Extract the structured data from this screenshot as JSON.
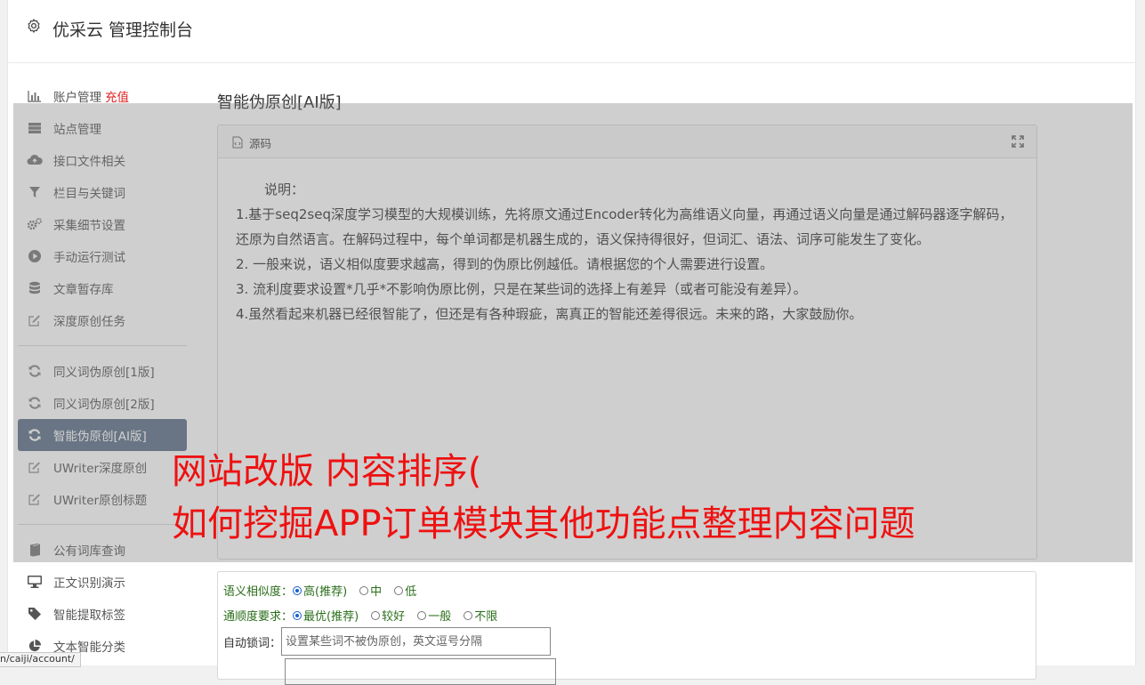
{
  "header": {
    "title": "优采云 管理控制台"
  },
  "sidebar": {
    "group1": [
      {
        "label": "账户管理",
        "extra": "充值",
        "icon": "bar-chart-icon"
      },
      {
        "label": "站点管理",
        "icon": "server-icon"
      },
      {
        "label": "接口文件相关",
        "icon": "cloud-upload-icon"
      },
      {
        "label": "栏目与关键词",
        "icon": "filter-icon"
      },
      {
        "label": "采集细节设置",
        "icon": "cogs-icon"
      },
      {
        "label": "手动运行测试",
        "icon": "play-icon"
      },
      {
        "label": "文章暂存库",
        "icon": "database-icon"
      },
      {
        "label": "深度原创任务",
        "icon": "edit-icon"
      }
    ],
    "group2": [
      {
        "label": "同义词伪原创[1版]",
        "icon": "refresh-icon"
      },
      {
        "label": "同义词伪原创[2版]",
        "icon": "refresh-icon"
      },
      {
        "label": "智能伪原创[AI版]",
        "icon": "refresh-icon",
        "active": true
      },
      {
        "label": "UWriter深度原创",
        "icon": "edit-icon"
      },
      {
        "label": "UWriter原创标题",
        "icon": "edit-icon"
      }
    ],
    "group3": [
      {
        "label": "公有词库查询",
        "icon": "book-icon"
      },
      {
        "label": "正文识别演示",
        "icon": "desktop-icon"
      },
      {
        "label": "智能提取标签",
        "icon": "tag-icon"
      },
      {
        "label": "文本智能分类",
        "icon": "pie-chart-icon"
      }
    ]
  },
  "main": {
    "title": "智能伪原创[AI版]",
    "panel": {
      "label": "源码",
      "lines": [
        "说明：",
        "1.基于seq2seq深度学习模型的大规模训练，先将原文通过Encoder转化为高维语义向量，再通过语义向量是通过解码器逐字解码，还原为自然语言。在解码过程中，每个单词都是机器生成的，语义保持得很好，但词汇、语法、词序可能发生了变化。",
        "2. 一般来说，语义相似度要求越高，得到的伪原比例越低。请根据您的个人需要进行设置。",
        "3. 流利度要求设置*几乎*不影响伪原比例，只是在某些词的选择上有差异（或者可能没有差异）。",
        "4.虽然看起来机器已经很智能了，但还是有各种瑕疵，离真正的智能还差得很远。未来的路，大家鼓励你。"
      ]
    },
    "overlay_text": [
      "网站改版 内容排序(",
      "如何挖掘APP订单模块其他功能点整理内容问题"
    ],
    "form": {
      "similarity": {
        "label": "语义相似度：",
        "options": [
          "高(推荐)",
          "中",
          "低"
        ],
        "selected": "高(推荐)"
      },
      "fluency": {
        "label": "通顺度要求：",
        "options": [
          "最优(推荐)",
          "较好",
          "一般",
          "不限"
        ],
        "selected": "最优(推荐)"
      },
      "lock": {
        "label": "自动锁词：",
        "placeholder": "设置某些词不被伪原创，英文逗号分隔"
      }
    }
  },
  "statusbar": {
    "url": "n/caiji/account/"
  }
}
